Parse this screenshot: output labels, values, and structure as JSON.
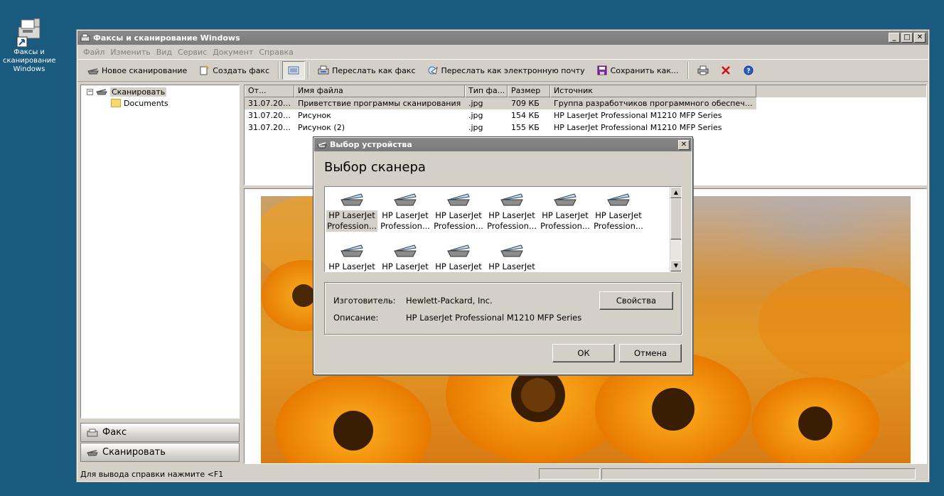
{
  "desktop": {
    "icon_label": "Факсы и сканирование Windows"
  },
  "window": {
    "title": "Факсы и сканирование Windows",
    "controls": {
      "minimize": "_",
      "maximize": "□",
      "close": "✕"
    }
  },
  "menu": [
    "Файл",
    "Изменить",
    "Вид",
    "Сервис",
    "Документ",
    "Справка"
  ],
  "toolbar": {
    "new_scan": "Новое сканирование",
    "create_fax": "Создать факс",
    "forward_fax": "Переслать как факс",
    "forward_email": "Переслать как электронную почту",
    "save_as": "Сохранить как..."
  },
  "tree": {
    "root": "Сканировать",
    "child": "Documents"
  },
  "nav": {
    "fax": "Факс",
    "scan": "Сканировать"
  },
  "list": {
    "columns": [
      "От...",
      "Имя файла",
      "Тип фа...",
      "Размер",
      "Источник"
    ],
    "rows": [
      [
        "31.07.201...",
        "Приветствие программы сканирования",
        ".jpg",
        "709 КБ",
        "Группа разработчиков программного обеспечения ..."
      ],
      [
        "31.07.201...",
        "Рисунок",
        ".jpg",
        "154 КБ",
        "HP LaserJet Professional M1210 MFP Series"
      ],
      [
        "31.07.201...",
        "Рисунок (2)",
        ".jpg",
        "155 КБ",
        "HP LaserJet Professional M1210 MFP Series"
      ]
    ]
  },
  "status": {
    "help": "Для вывода справки нажмите <F1"
  },
  "dialog": {
    "title": "Выбор устройства",
    "heading": "Выбор сканера",
    "scanner_label_line1": "HP LaserJet",
    "scanner_label_line2": "Professio...",
    "scanner_label_line2_full": "Profession...",
    "manufacturer_key": "Изготовитель:",
    "manufacturer_value": "Hewlett-Packard, Inc.",
    "description_key": "Описание:",
    "description_value": "HP LaserJet Professional M1210 MFP Series",
    "properties_button": "Свойства",
    "ok_button": "ОК",
    "cancel_button": "Отмена"
  }
}
